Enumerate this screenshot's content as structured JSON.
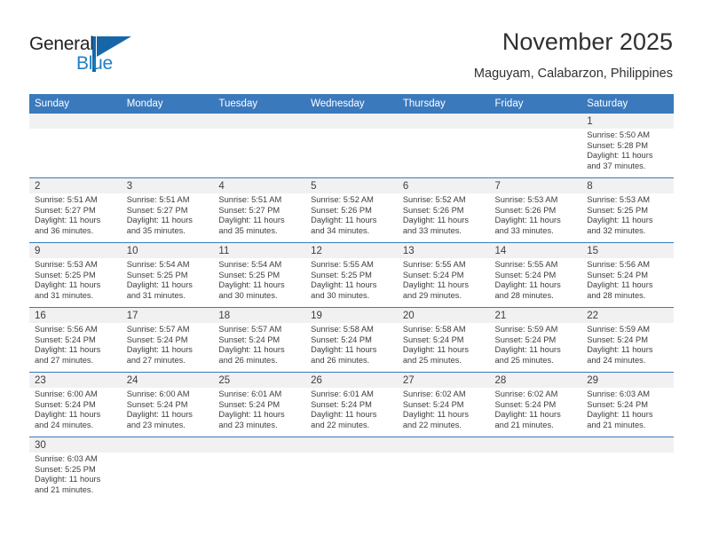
{
  "brand": {
    "name_top": "General",
    "name_bottom": "Blue",
    "accent_color": "#1767a8",
    "text_color": "#231f20"
  },
  "header": {
    "title": "November 2025",
    "subtitle": "Maguyam, Calabarzon, Philippines"
  },
  "theme": {
    "header_row_bg": "#3b79bd",
    "daynum_band_bg": "#f1f1f1",
    "grid_line": "#3b79bd",
    "text": "#3d3d3d"
  },
  "calendar": {
    "month": "November",
    "year": "2025",
    "weekday_headers": [
      "Sunday",
      "Monday",
      "Tuesday",
      "Wednesday",
      "Thursday",
      "Friday",
      "Saturday"
    ],
    "weeks": [
      [
        {
          "day": "",
          "lines": []
        },
        {
          "day": "",
          "lines": []
        },
        {
          "day": "",
          "lines": []
        },
        {
          "day": "",
          "lines": []
        },
        {
          "day": "",
          "lines": []
        },
        {
          "day": "",
          "lines": []
        },
        {
          "day": "1",
          "lines": [
            "Sunrise: 5:50 AM",
            "Sunset: 5:28 PM",
            "Daylight: 11 hours",
            "and 37 minutes."
          ]
        }
      ],
      [
        {
          "day": "2",
          "lines": [
            "Sunrise: 5:51 AM",
            "Sunset: 5:27 PM",
            "Daylight: 11 hours",
            "and 36 minutes."
          ]
        },
        {
          "day": "3",
          "lines": [
            "Sunrise: 5:51 AM",
            "Sunset: 5:27 PM",
            "Daylight: 11 hours",
            "and 35 minutes."
          ]
        },
        {
          "day": "4",
          "lines": [
            "Sunrise: 5:51 AM",
            "Sunset: 5:27 PM",
            "Daylight: 11 hours",
            "and 35 minutes."
          ]
        },
        {
          "day": "5",
          "lines": [
            "Sunrise: 5:52 AM",
            "Sunset: 5:26 PM",
            "Daylight: 11 hours",
            "and 34 minutes."
          ]
        },
        {
          "day": "6",
          "lines": [
            "Sunrise: 5:52 AM",
            "Sunset: 5:26 PM",
            "Daylight: 11 hours",
            "and 33 minutes."
          ]
        },
        {
          "day": "7",
          "lines": [
            "Sunrise: 5:53 AM",
            "Sunset: 5:26 PM",
            "Daylight: 11 hours",
            "and 33 minutes."
          ]
        },
        {
          "day": "8",
          "lines": [
            "Sunrise: 5:53 AM",
            "Sunset: 5:25 PM",
            "Daylight: 11 hours",
            "and 32 minutes."
          ]
        }
      ],
      [
        {
          "day": "9",
          "lines": [
            "Sunrise: 5:53 AM",
            "Sunset: 5:25 PM",
            "Daylight: 11 hours",
            "and 31 minutes."
          ]
        },
        {
          "day": "10",
          "lines": [
            "Sunrise: 5:54 AM",
            "Sunset: 5:25 PM",
            "Daylight: 11 hours",
            "and 31 minutes."
          ]
        },
        {
          "day": "11",
          "lines": [
            "Sunrise: 5:54 AM",
            "Sunset: 5:25 PM",
            "Daylight: 11 hours",
            "and 30 minutes."
          ]
        },
        {
          "day": "12",
          "lines": [
            "Sunrise: 5:55 AM",
            "Sunset: 5:25 PM",
            "Daylight: 11 hours",
            "and 30 minutes."
          ]
        },
        {
          "day": "13",
          "lines": [
            "Sunrise: 5:55 AM",
            "Sunset: 5:24 PM",
            "Daylight: 11 hours",
            "and 29 minutes."
          ]
        },
        {
          "day": "14",
          "lines": [
            "Sunrise: 5:55 AM",
            "Sunset: 5:24 PM",
            "Daylight: 11 hours",
            "and 28 minutes."
          ]
        },
        {
          "day": "15",
          "lines": [
            "Sunrise: 5:56 AM",
            "Sunset: 5:24 PM",
            "Daylight: 11 hours",
            "and 28 minutes."
          ]
        }
      ],
      [
        {
          "day": "16",
          "lines": [
            "Sunrise: 5:56 AM",
            "Sunset: 5:24 PM",
            "Daylight: 11 hours",
            "and 27 minutes."
          ]
        },
        {
          "day": "17",
          "lines": [
            "Sunrise: 5:57 AM",
            "Sunset: 5:24 PM",
            "Daylight: 11 hours",
            "and 27 minutes."
          ]
        },
        {
          "day": "18",
          "lines": [
            "Sunrise: 5:57 AM",
            "Sunset: 5:24 PM",
            "Daylight: 11 hours",
            "and 26 minutes."
          ]
        },
        {
          "day": "19",
          "lines": [
            "Sunrise: 5:58 AM",
            "Sunset: 5:24 PM",
            "Daylight: 11 hours",
            "and 26 minutes."
          ]
        },
        {
          "day": "20",
          "lines": [
            "Sunrise: 5:58 AM",
            "Sunset: 5:24 PM",
            "Daylight: 11 hours",
            "and 25 minutes."
          ]
        },
        {
          "day": "21",
          "lines": [
            "Sunrise: 5:59 AM",
            "Sunset: 5:24 PM",
            "Daylight: 11 hours",
            "and 25 minutes."
          ]
        },
        {
          "day": "22",
          "lines": [
            "Sunrise: 5:59 AM",
            "Sunset: 5:24 PM",
            "Daylight: 11 hours",
            "and 24 minutes."
          ]
        }
      ],
      [
        {
          "day": "23",
          "lines": [
            "Sunrise: 6:00 AM",
            "Sunset: 5:24 PM",
            "Daylight: 11 hours",
            "and 24 minutes."
          ]
        },
        {
          "day": "24",
          "lines": [
            "Sunrise: 6:00 AM",
            "Sunset: 5:24 PM",
            "Daylight: 11 hours",
            "and 23 minutes."
          ]
        },
        {
          "day": "25",
          "lines": [
            "Sunrise: 6:01 AM",
            "Sunset: 5:24 PM",
            "Daylight: 11 hours",
            "and 23 minutes."
          ]
        },
        {
          "day": "26",
          "lines": [
            "Sunrise: 6:01 AM",
            "Sunset: 5:24 PM",
            "Daylight: 11 hours",
            "and 22 minutes."
          ]
        },
        {
          "day": "27",
          "lines": [
            "Sunrise: 6:02 AM",
            "Sunset: 5:24 PM",
            "Daylight: 11 hours",
            "and 22 minutes."
          ]
        },
        {
          "day": "28",
          "lines": [
            "Sunrise: 6:02 AM",
            "Sunset: 5:24 PM",
            "Daylight: 11 hours",
            "and 21 minutes."
          ]
        },
        {
          "day": "29",
          "lines": [
            "Sunrise: 6:03 AM",
            "Sunset: 5:24 PM",
            "Daylight: 11 hours",
            "and 21 minutes."
          ]
        }
      ],
      [
        {
          "day": "30",
          "lines": [
            "Sunrise: 6:03 AM",
            "Sunset: 5:25 PM",
            "Daylight: 11 hours",
            "and 21 minutes."
          ]
        },
        {
          "day": "",
          "lines": []
        },
        {
          "day": "",
          "lines": []
        },
        {
          "day": "",
          "lines": []
        },
        {
          "day": "",
          "lines": []
        },
        {
          "day": "",
          "lines": []
        },
        {
          "day": "",
          "lines": []
        }
      ]
    ]
  }
}
